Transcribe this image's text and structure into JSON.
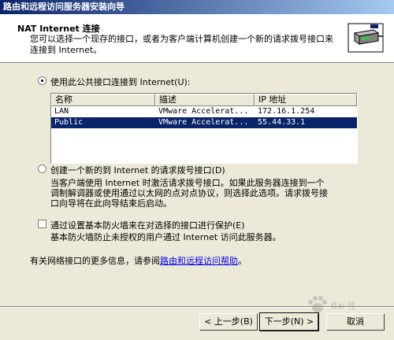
{
  "window": {
    "title": "路由和远程访问服务器安装向导"
  },
  "header": {
    "title": "NAT Internet 连接",
    "description": "您可以选择一个现存的接口，或者为客户端计算机创建一个新的请求拨号接口来连接到 Internet。"
  },
  "option_existing": {
    "label": "使用此公共接口连接到 Internet(U):",
    "selected": true
  },
  "interfaces": {
    "columns": [
      "名称",
      "描述",
      "IP 地址"
    ],
    "rows": [
      {
        "name": "LAN",
        "description": "VMware Accelerat...",
        "ip": "172.16.1.254",
        "selected": false
      },
      {
        "name": "Public",
        "description": "VMware Accelerat...",
        "ip": "55.44.33.1",
        "selected": true
      }
    ]
  },
  "option_new": {
    "label": "创建一个新的到 Internet 的请求拨号接口(D)",
    "selected": false,
    "description_lines": [
      "当客户端使用 Internet 时激活请求拨号接口。如果此服务器连接到一个",
      "调制解调器或使用通过以太网的点对点协议，则选择此选项。请求拨号接",
      "口向导将在此向导结束后启动。"
    ]
  },
  "firewall": {
    "label": "通过设置基本防火墙来在对选择的接口进行保护(E)",
    "checked": false,
    "description": "基本防火墙防止未授权的用户通过 Internet 访问此服务器。"
  },
  "footer": {
    "info_prefix": "有关网络接口的更多信息，请参阅",
    "help_link": "路由和远程访问帮助",
    "info_suffix": "。"
  },
  "buttons": {
    "back": "< 上一步(B)",
    "next": "下一步(N) >",
    "cancel": "取消"
  },
  "watermark": {
    "text": "Bai 经验"
  }
}
